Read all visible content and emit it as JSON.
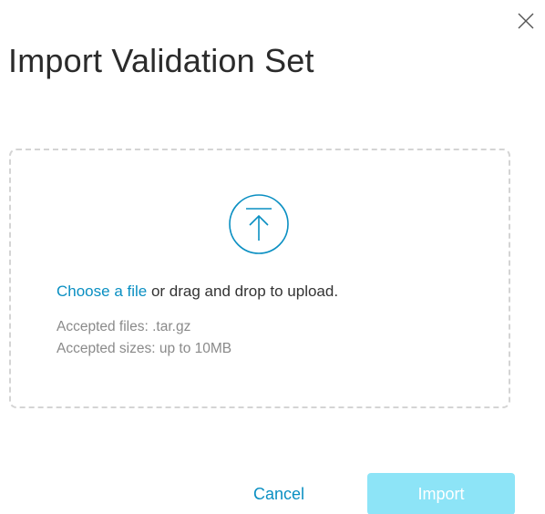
{
  "dialog": {
    "title": "Import Validation Set",
    "close_icon": "close-icon"
  },
  "dropzone": {
    "upload_icon": "upload-arrow-icon",
    "choose_link": "Choose a file",
    "drag_text": " or drag and drop to upload.",
    "accepted_files": "Accepted files: .tar.gz",
    "accepted_sizes": "Accepted sizes: up to 10MB"
  },
  "footer": {
    "cancel_label": "Cancel",
    "import_label": "Import",
    "import_disabled": true
  },
  "colors": {
    "accent": "#0a8fc2",
    "import_button_bg": "#8de4f7",
    "title_text": "#2b2b2b",
    "muted_text": "#8a8a8a",
    "dropzone_border": "#d4d4d4"
  }
}
